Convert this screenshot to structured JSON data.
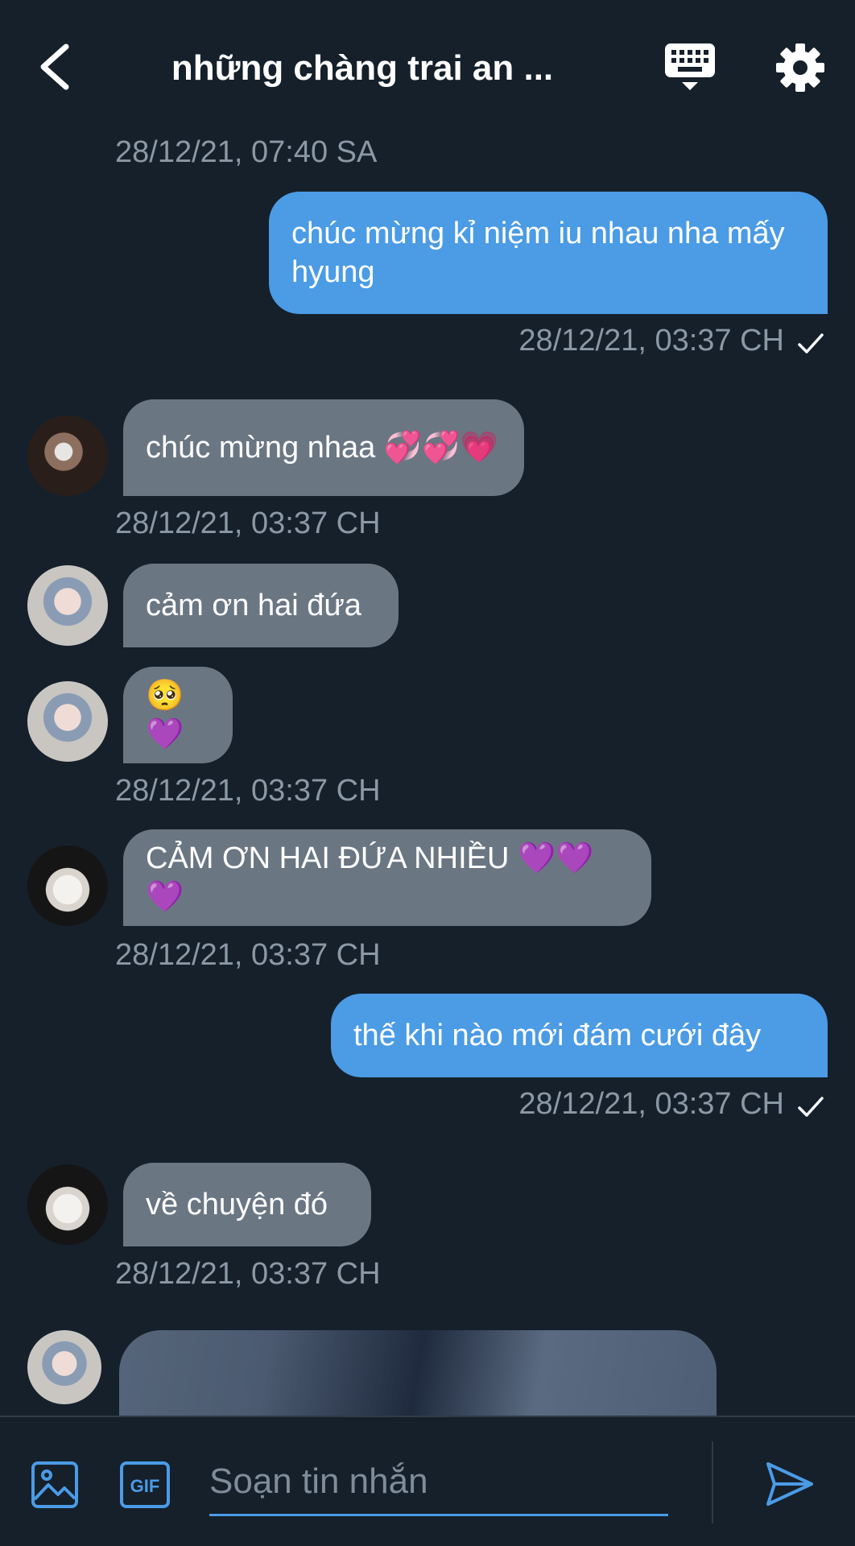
{
  "header": {
    "title": "những chàng trai an ...",
    "back_icon": "chevron-left-icon",
    "keyboard_icon": "keyboard-icon",
    "settings_icon": "gear-icon"
  },
  "messages": [
    {
      "type": "timestamp",
      "text": "28/12/21, 07:40 SA"
    },
    {
      "type": "outgoing",
      "text": "chúc mừng kỉ niệm iu nhau nha mấy hyung",
      "time": "28/12/21, 03:37 CH"
    },
    {
      "type": "incoming",
      "text": "chúc mừng nhaa 💞💞💗",
      "time": "28/12/21, 03:37 CH"
    },
    {
      "type": "incoming",
      "text": "cảm ơn hai đứa"
    },
    {
      "type": "incoming",
      "text": "🥺💜",
      "time": "28/12/21, 03:37 CH"
    },
    {
      "type": "incoming",
      "text": "CẢM ƠN HAI ĐỨA NHIỀU 💜💜💜",
      "time": "28/12/21, 03:37 CH"
    },
    {
      "type": "outgoing",
      "text": "thế khi nào mới đám cưới đây",
      "time": "28/12/21, 03:37 CH"
    },
    {
      "type": "incoming",
      "text": "về chuyện đó",
      "time": "28/12/21, 03:37 CH"
    },
    {
      "type": "incoming-image"
    }
  ],
  "composer": {
    "placeholder": "Soạn tin nhắn",
    "image_icon": "image-icon",
    "gif_icon": "gif-icon",
    "gif_label": "GIF",
    "send_icon": "send-icon"
  },
  "colors": {
    "background": "#15202b",
    "outgoing_bubble": "#4b9be5",
    "incoming_bubble": "#6b7683",
    "timestamp": "#8b98a5",
    "accent": "#4b9be5"
  }
}
